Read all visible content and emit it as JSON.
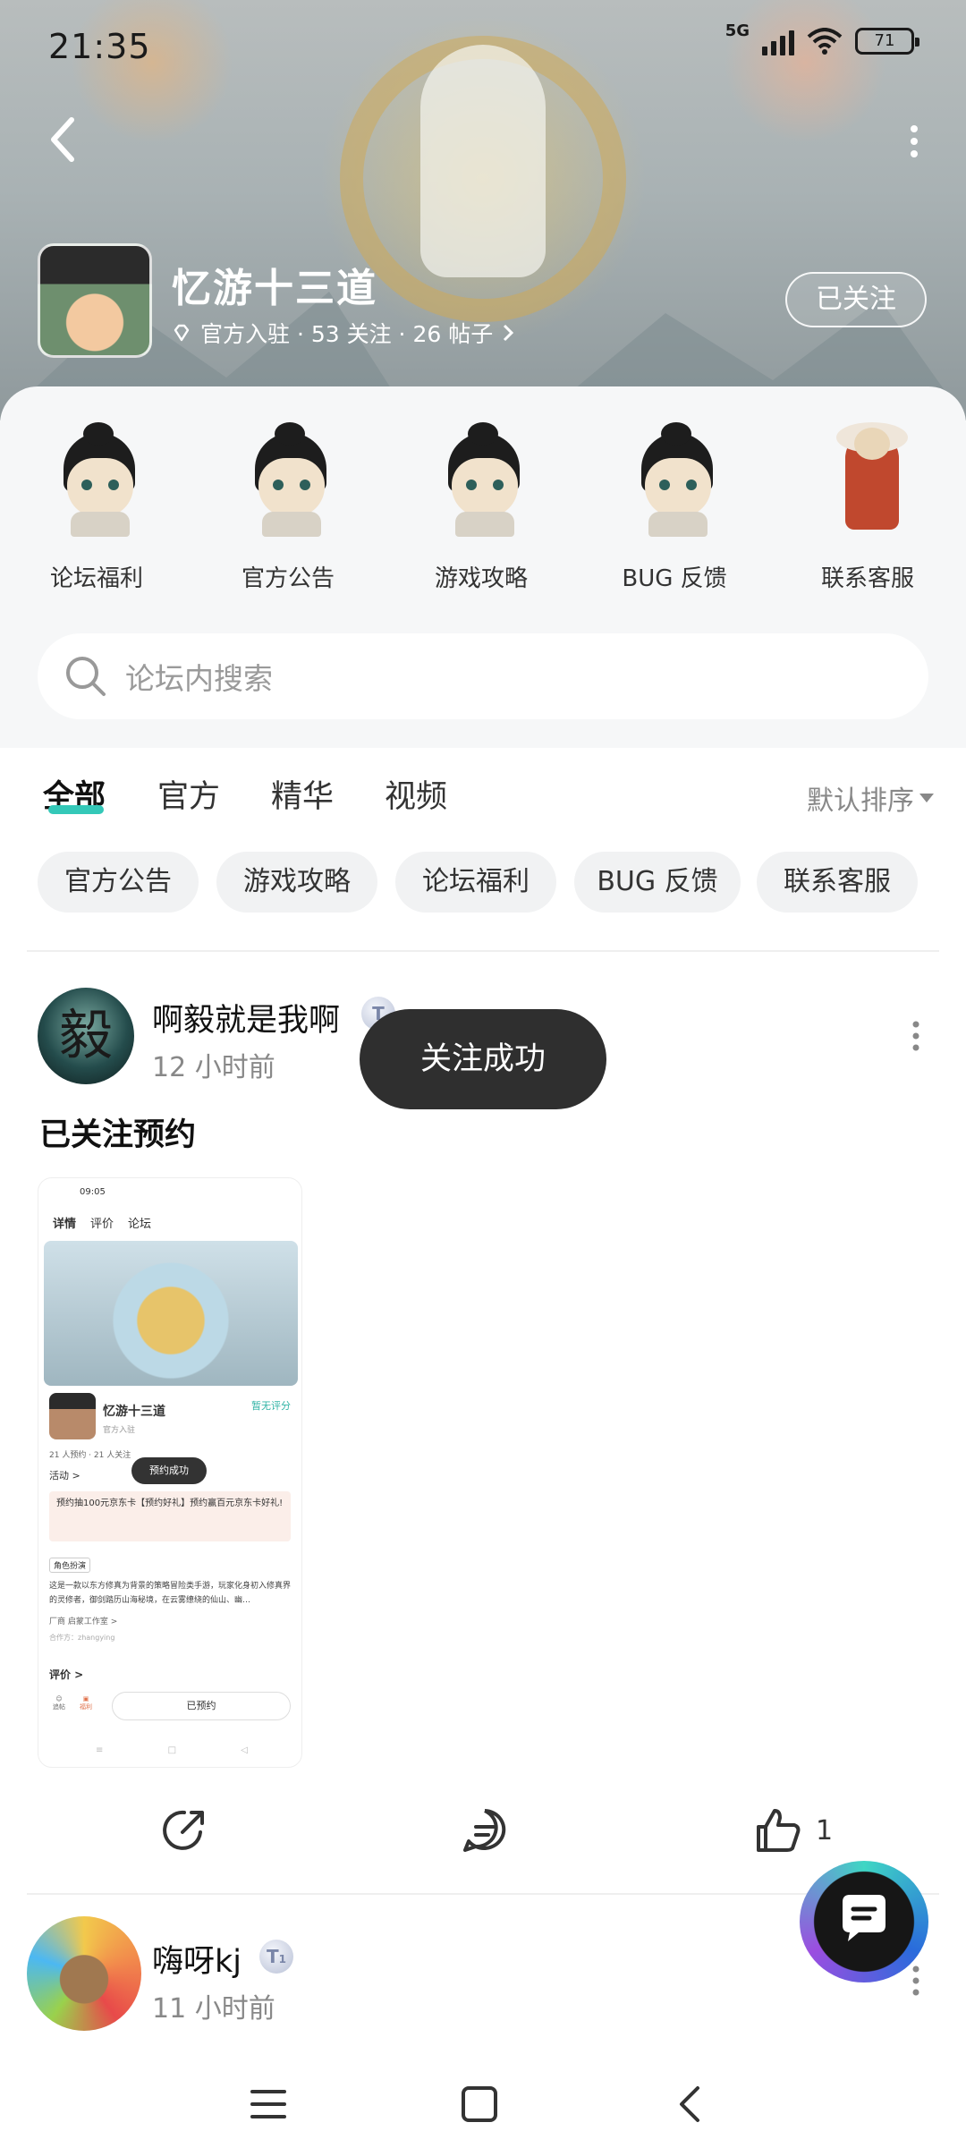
{
  "status_bar": {
    "time": "21:35",
    "network": "5G",
    "battery": "71"
  },
  "forum": {
    "title": "忆游十三道",
    "meta": "官方入驻 · 53 关注 · 26 帖子",
    "follow_label": "已关注"
  },
  "shortcuts": [
    {
      "label": "论坛福利",
      "icon": "character-avatar-icon"
    },
    {
      "label": "官方公告",
      "icon": "character-avatar-icon"
    },
    {
      "label": "游戏攻略",
      "icon": "character-avatar-icon"
    },
    {
      "label": "BUG 反馈",
      "icon": "character-avatar-icon"
    },
    {
      "label": "联系客服",
      "icon": "warrior-figure-icon"
    }
  ],
  "search": {
    "placeholder": "论坛内搜索"
  },
  "tabs": [
    {
      "label": "全部",
      "active": true
    },
    {
      "label": "官方",
      "active": false
    },
    {
      "label": "精华",
      "active": false
    },
    {
      "label": "视频",
      "active": false
    }
  ],
  "sort_label": "默认排序",
  "chips": [
    "官方公告",
    "游戏攻略",
    "论坛福利",
    "BUG 反馈",
    "联系客服"
  ],
  "posts": [
    {
      "avatar_char": "毅",
      "author": "啊毅就是我啊",
      "level": "T",
      "time": "12 小时前",
      "text": "已关注预约",
      "image": {
        "status_time": "09:05",
        "tab_detail": "详情",
        "tab_review": "评价",
        "tab_forum": "论坛",
        "game_title": "忆游十三道",
        "rating": "暂无评分",
        "official": "官方入驻",
        "counts": "21 人预约 · 21 人关注",
        "activity": "活动 >",
        "toast": "预约成功",
        "promo": "预约抽100元京东卡【预约好礼】预约赢百元京东卡好礼!",
        "tag": "角色扮演",
        "desc": "这是一款以东方修真为背景的策略冒险类手游，玩家化身初入修真界的灵修者，御剑踏历山海秘境，在云雾缭绕的仙山、幽…",
        "developer": "厂商  启蒙工作室 >",
        "publisher": "合作方：zhangying",
        "review": "评价 >",
        "icon_fav": "追帖",
        "icon_gift": "福利",
        "reserved": "已预约"
      },
      "likes": "1"
    },
    {
      "author": "嗨呀kj",
      "level": "T",
      "level_sub": "1",
      "time": "11 小时前"
    }
  ],
  "toast": "关注成功",
  "colors": {
    "accent": "#34c8b8",
    "toast_bg": "#2f2f2f"
  }
}
